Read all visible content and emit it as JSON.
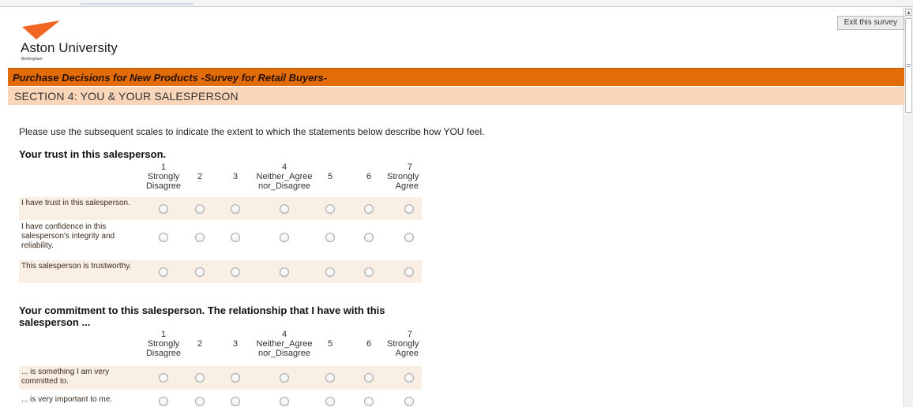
{
  "survey": {
    "exit_label": "Exit this survey",
    "logo": {
      "name": "Aston University",
      "sub": "Birmingham",
      "triangle_color": "#f26522"
    },
    "title": "Purchase Decisions for New Products -Survey for Retail Buyers-",
    "section": "SECTION 4: YOU & YOUR SALESPERSON",
    "instruction": "Please use the subsequent scales to indicate the extent to which the statements below describe how YOU feel."
  },
  "scale": [
    {
      "num": "1",
      "text1": "Strongly",
      "text2": "Disagree"
    },
    {
      "num": "2",
      "text1": "",
      "text2": ""
    },
    {
      "num": "3",
      "text1": "",
      "text2": ""
    },
    {
      "num": "4",
      "text1": "Neither_Agree",
      "text2": "nor_Disagree"
    },
    {
      "num": "5",
      "text1": "",
      "text2": ""
    },
    {
      "num": "6",
      "text1": "",
      "text2": ""
    },
    {
      "num": "7",
      "text1": "Strongly",
      "text2": "Agree"
    }
  ],
  "questions": [
    {
      "title": "Your trust in this salesperson.",
      "rows": [
        {
          "label": "I have trust in this salesperson."
        },
        {
          "label": "I have confidence in this salesperson's integrity and reliability."
        },
        {
          "label": "This salesperson is trustworthy."
        }
      ]
    },
    {
      "title": "Your commitment to this salesperson. The relationship that I have with this salesperson ...",
      "rows": [
        {
          "label": "... is something I am very committed to."
        },
        {
          "label": "... is very important to me."
        }
      ]
    }
  ],
  "colors": {
    "title_bar": "#e36c0a",
    "section_bar": "#f9d6b9",
    "row_shade": "#faefe4"
  }
}
